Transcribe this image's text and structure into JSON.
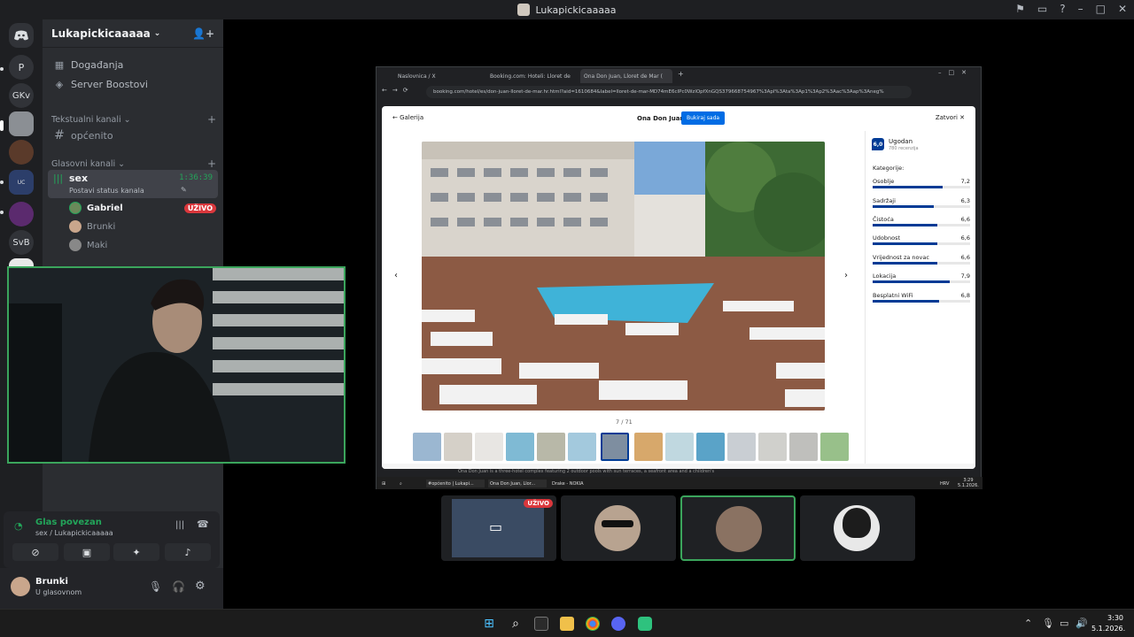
{
  "window": {
    "title": "Lukapickicaaaaa"
  },
  "guilds": {
    "p_label": "P",
    "gkv_label": "GKv",
    "svb_label": "SvB",
    "uc_label": "UC"
  },
  "server": {
    "name": "Lukapickicaaaaa",
    "events": "Događanja",
    "boosts": "Server Boostovi",
    "text_category": "Tekstualni kanali",
    "text_channel": "općenito",
    "voice_category": "Glasovni kanali",
    "voice_channel": "sex",
    "voice_timer": "1:36:39",
    "voice_status": "Postavi status kanala",
    "members": [
      {
        "name": "Gabriel",
        "live": "UŽIVO"
      },
      {
        "name": "Brunki"
      },
      {
        "name": "Maki"
      }
    ]
  },
  "voice_panel": {
    "status": "Glas povezan",
    "location": "sex / Lukapickicaaaaa"
  },
  "user": {
    "name": "Brunki",
    "status": "U glasovnom"
  },
  "browser": {
    "tabs": [
      "Naslovnica / X",
      "Booking.com: Hoteli: Lloret de",
      "Ona Don Juan, Lloret de Mar ("
    ],
    "url": "booking.com/hotel/es/don-juan-lloret-de-mar.hr.html?aid=1610684&label=lloret-de-mar-MD74mE6cIPc0WzlOpfXnGQS379668754967%3Apl%3Ata%3Ap1%3Ap2%3Aac%3Aap%3Aneg%",
    "gallery_back": "Galerija",
    "hotel_name": "Ona Don Juan",
    "book_button": "Bukiraj sada",
    "close": "Zatvori",
    "photo_counter": "7 / 71",
    "score": "6,0",
    "score_label": "Ugodan",
    "reviews": "780 recenzija",
    "categories_title": "Kategorije:",
    "categories": [
      {
        "name": "Osoblje",
        "value": "7,2",
        "score": 7.2
      },
      {
        "name": "Sadržaji",
        "value": "6,3",
        "score": 6.3
      },
      {
        "name": "Čistoća",
        "value": "6,6",
        "score": 6.6
      },
      {
        "name": "Udobnost",
        "value": "6,6",
        "score": 6.6
      },
      {
        "name": "Vrijednost za novac",
        "value": "6,6",
        "score": 6.6
      },
      {
        "name": "Lokacija",
        "value": "7,9",
        "score": 7.9
      },
      {
        "name": "Besplatni WiFi",
        "value": "6,8",
        "score": 6.8
      }
    ],
    "footer_text": "Ona Don Juan is a three-hotel complex featuring 2 outdoor pools with sun terraces, a seafront area and a children's",
    "taskbar": {
      "discord": "#općenito | Lukapi...",
      "chrome": "Ona Don Juan, Llor...",
      "spotify": "Drake - NOKIA",
      "lang": "HRV",
      "time": "3:29",
      "date": "5.1.2026."
    }
  },
  "tiles": {
    "live_badge": "UŽIVO"
  },
  "taskbar": {
    "time": "3:30",
    "date": "5.1.2026."
  }
}
